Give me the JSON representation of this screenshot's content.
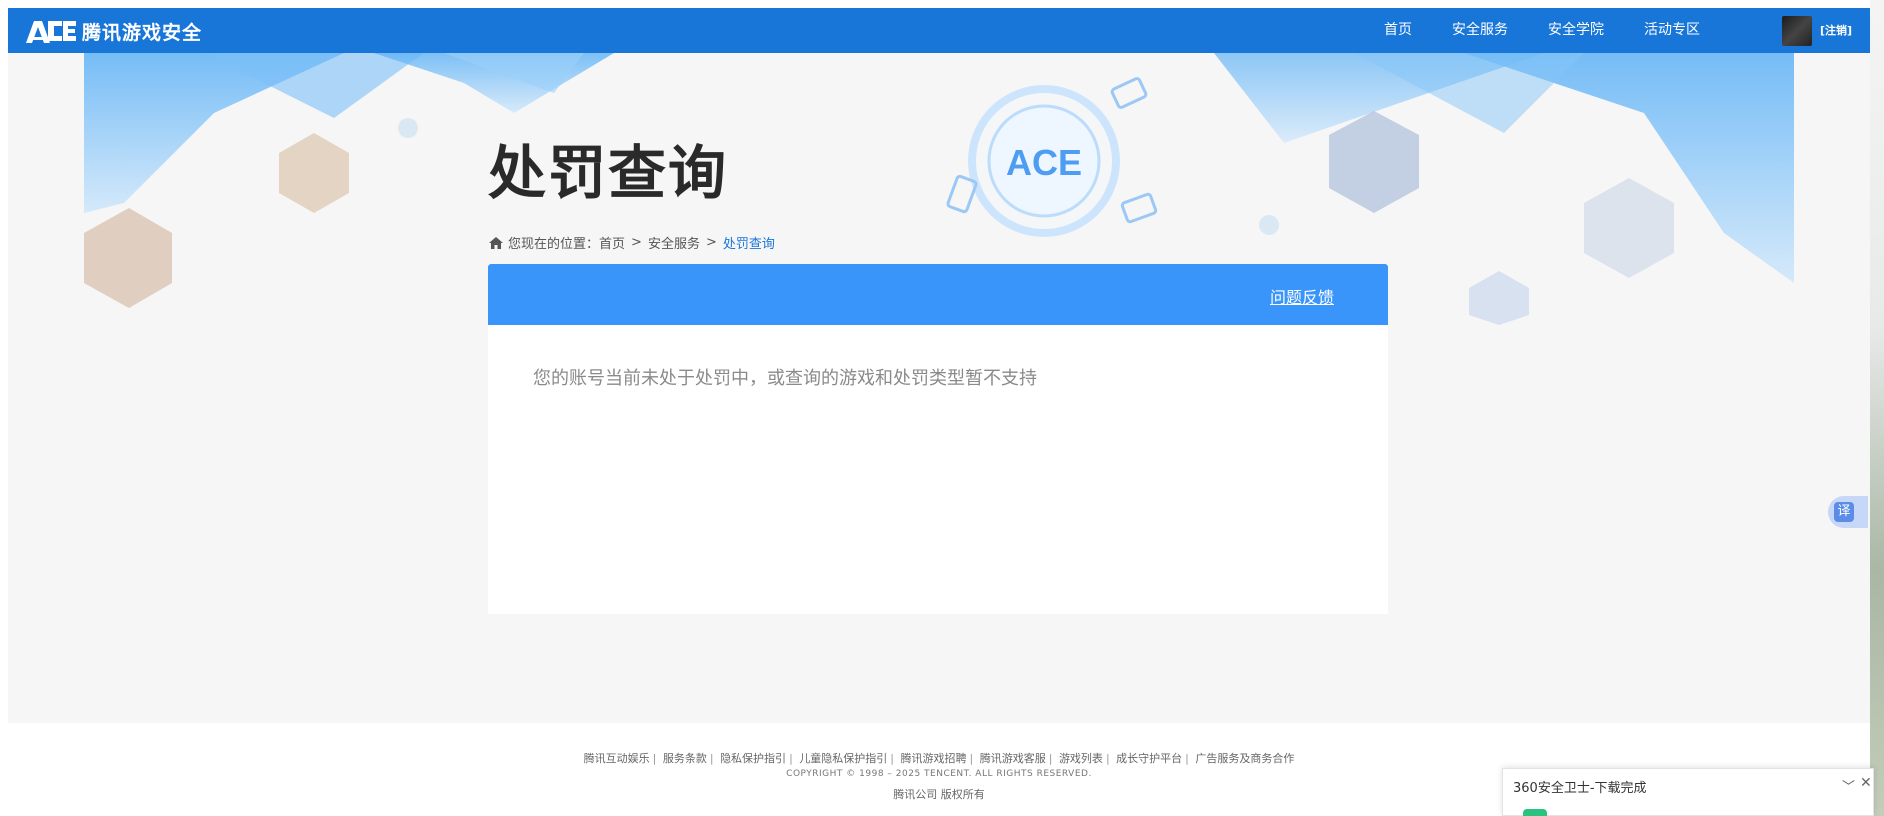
{
  "header": {
    "logo_text": "腾讯游戏安全",
    "nav": [
      "首页",
      "安全服务",
      "安全学院",
      "活动专区"
    ],
    "logout_label": "[注销]"
  },
  "page": {
    "title": "处罚查询"
  },
  "breadcrumb": {
    "prefix": "您现在的位置：",
    "items": [
      "首页",
      "安全服务"
    ],
    "separator": ">",
    "current": "处罚查询"
  },
  "card": {
    "feedback_label": "问题反馈",
    "message": "您的账号当前未处于处罚中，或查询的游戏和处罚类型暂不支持"
  },
  "footer": {
    "links": [
      "腾讯互动娱乐",
      "服务条款",
      "隐私保护指引",
      "儿童隐私保护指引",
      "腾讯游戏招聘",
      "腾讯游戏客服",
      "游戏列表",
      "成长守护平台",
      "广告服务及商务合作"
    ],
    "link_separator": "|",
    "copyright": "COPYRIGHT © 1998 – 2025 TENCENT. ALL RIGHTS RESERVED.",
    "rights": "腾讯公司 版权所有"
  },
  "translate_button": {
    "label": "译"
  },
  "download_panel": {
    "text": "360安全卫士-下载完成",
    "chevron": "﹀",
    "close": "✕"
  },
  "colors": {
    "header_bg": "#1976d9",
    "card_header_bg": "#3a95fb",
    "breadcrumb_current": "#1976d9",
    "page_bg": "#f6f6f6"
  },
  "icons": [
    "ace-logo-icon",
    "home-icon",
    "chevron-down-icon",
    "close-icon",
    "translate-icon"
  ]
}
